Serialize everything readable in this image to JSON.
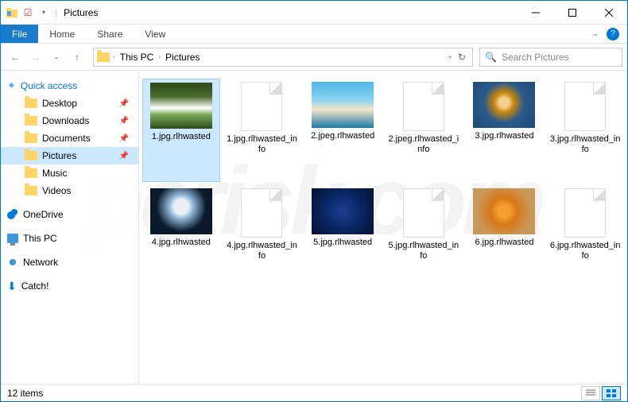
{
  "window": {
    "title": "Pictures"
  },
  "ribbon": {
    "file": "File",
    "tabs": [
      "Home",
      "Share",
      "View"
    ]
  },
  "breadcrumb": {
    "root": "This PC",
    "current": "Pictures"
  },
  "search": {
    "placeholder": "Search Pictures"
  },
  "sidebar": {
    "quick_access": "Quick access",
    "items": [
      {
        "label": "Desktop",
        "pinned": true
      },
      {
        "label": "Downloads",
        "pinned": true
      },
      {
        "label": "Documents",
        "pinned": true
      },
      {
        "label": "Pictures",
        "pinned": true,
        "selected": true
      },
      {
        "label": "Music",
        "pinned": false
      },
      {
        "label": "Videos",
        "pinned": false
      }
    ],
    "onedrive": "OneDrive",
    "thispc": "This PC",
    "network": "Network",
    "catch": "Catch!"
  },
  "files": [
    {
      "name": "1.jpg.rlhwasted",
      "type": "img",
      "selected": true,
      "bg": "linear-gradient(to bottom,#2d4a1a 0%,#4a6b2a 30%,#fff 55%,#7aa855 70%,#2d4a1a 100%)"
    },
    {
      "name": "1.jpg.rlhwasted_info",
      "type": "blank"
    },
    {
      "name": "2.jpeg.rlhwasted",
      "type": "img",
      "bg": "linear-gradient(to bottom,#4db8e8 0%,#8dd4f0 40%,#f5e6c8 60%,#1a7aa8 100%)"
    },
    {
      "name": "2.jpeg.rlhwasted_info",
      "type": "blank"
    },
    {
      "name": "3.jpg.rlhwasted",
      "type": "img",
      "bg": "radial-gradient(circle at 50% 45%,#f5d090 12%,#c8860a 25%,#2a5a8a 50%,#1a4a7a 100%)"
    },
    {
      "name": "3.jpg.rlhwasted_info",
      "type": "blank"
    },
    {
      "name": "4.jpg.rlhwasted",
      "type": "img",
      "bg": "radial-gradient(circle at 50% 40%,#e8f0f5 18%,#8ab0d0 30%,#0a1a2a 60%)"
    },
    {
      "name": "4.jpg.rlhwasted_info",
      "type": "blank"
    },
    {
      "name": "5.jpg.rlhwasted",
      "type": "img",
      "bg": "radial-gradient(circle at 50% 50%,#1a3a8a 10%,#0a2a6a 40%,#051030 100%)"
    },
    {
      "name": "5.jpg.rlhwasted_info",
      "type": "blank"
    },
    {
      "name": "6.jpg.rlhwasted",
      "type": "img",
      "bg": "radial-gradient(circle at 50% 50%,#f5a030 15%,#d87818 35%,#c89858 70%)"
    },
    {
      "name": "6.jpg.rlhwasted_info",
      "type": "blank"
    }
  ],
  "status": {
    "count": "12 items"
  },
  "watermark": "pcrisk.com"
}
